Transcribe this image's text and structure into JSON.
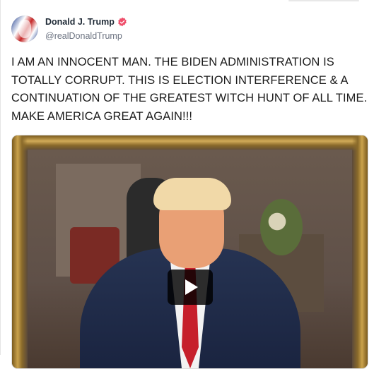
{
  "top_strip": {
    "color": "#e8e8e8"
  },
  "post": {
    "author": {
      "display_name": "Donald J. Trump",
      "handle": "@realDonaldTrump",
      "verified_color": "#ef4f6b",
      "avatar_colors": [
        "#1d3c8f",
        "#c62828"
      ]
    },
    "text": "I AM AN INNOCENT MAN. THE BIDEN ADMINISTRATION IS TOTALLY CORRUPT. THIS IS ELECTION INTERFERENCE & A CONTINUATION OF THE GREATEST WITCH HUNT OF ALL TIME. MAKE AMERICA GREAT AGAIN!!!",
    "media": {
      "type": "video",
      "play_button": {
        "icon": "play-icon"
      },
      "frame_colors": [
        "#caa24c",
        "#7a5a1e"
      ],
      "tie_color": "#c61f2b"
    }
  }
}
